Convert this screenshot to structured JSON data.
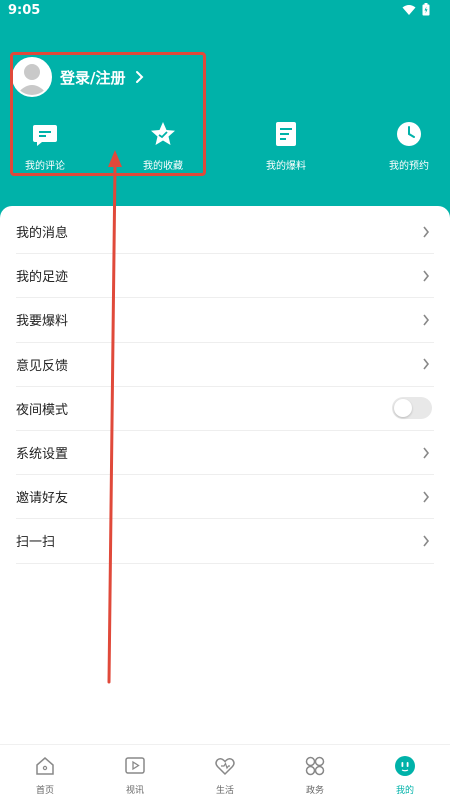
{
  "status": {
    "time": "9:05"
  },
  "profile": {
    "login_label": "登录/注册"
  },
  "quick_actions": [
    {
      "label": "我的评论",
      "icon": "comment-icon"
    },
    {
      "label": "我的收藏",
      "icon": "star-icon"
    },
    {
      "label": "我的爆料",
      "icon": "document-icon"
    },
    {
      "label": "我的预约",
      "icon": "clock-icon"
    }
  ],
  "menu": [
    {
      "label": "我的消息",
      "type": "link"
    },
    {
      "label": "我的足迹",
      "type": "link"
    },
    {
      "label": "我要爆料",
      "type": "link"
    },
    {
      "label": "意见反馈",
      "type": "link"
    },
    {
      "label": "夜间模式",
      "type": "toggle",
      "on": false
    },
    {
      "label": "系统设置",
      "type": "link"
    },
    {
      "label": "邀请好友",
      "type": "link"
    },
    {
      "label": "扫一扫",
      "type": "link"
    }
  ],
  "tabs": [
    {
      "label": "首页",
      "icon": "home-icon"
    },
    {
      "label": "视讯",
      "icon": "video-icon"
    },
    {
      "label": "生活",
      "icon": "heart-icon"
    },
    {
      "label": "政务",
      "icon": "grid-icon"
    },
    {
      "label": "我的",
      "icon": "profile-icon",
      "active": true
    }
  ],
  "colors": {
    "brand": "#00b2a9",
    "annotation": "#e0493a"
  }
}
